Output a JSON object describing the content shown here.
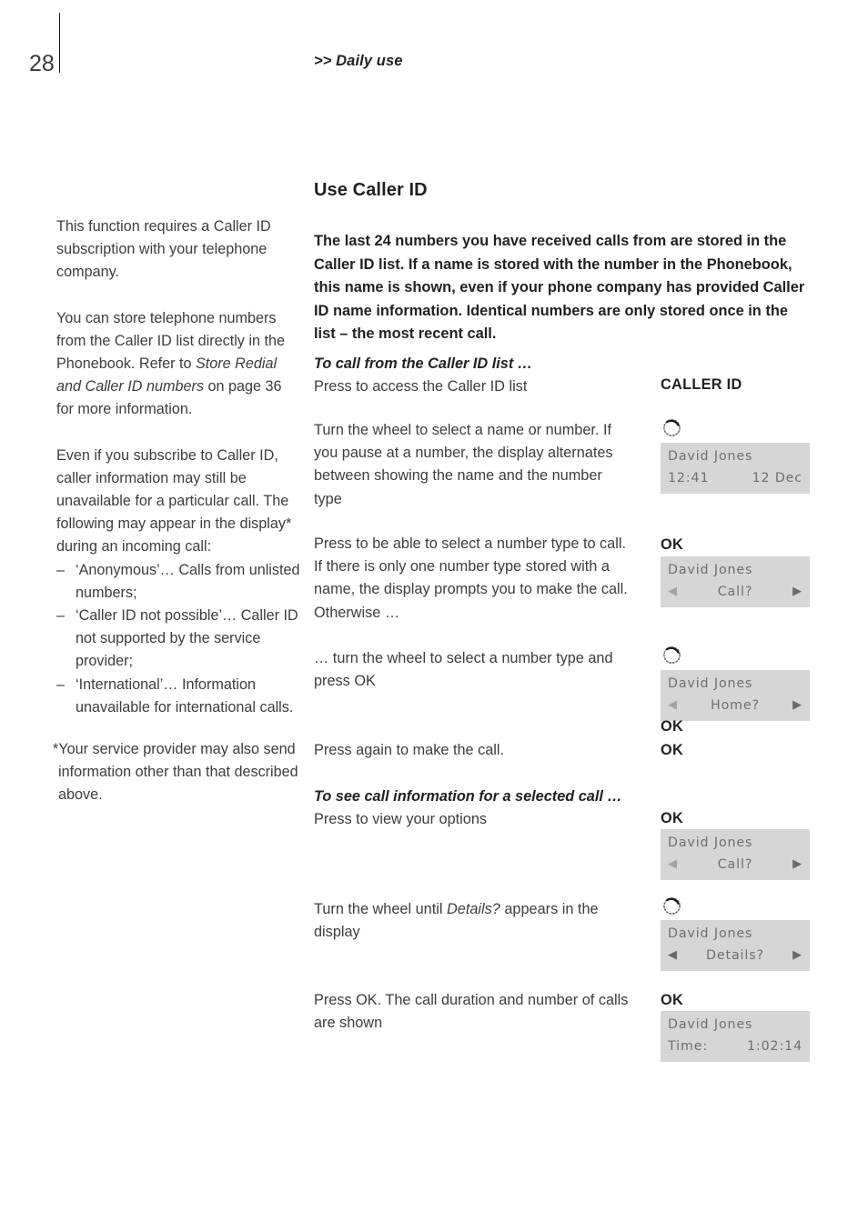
{
  "header": {
    "page_number": "28",
    "breadcrumb": ">> Daily use"
  },
  "sidebar": {
    "para1": "This function requires a Caller ID subscription with your telephone company.",
    "para2_a": "You can store telephone numbers from the Caller ID list directly in the Phonebook. Refer to ",
    "para2_em": "Store Redial and Caller ID numbers",
    "para2_b": " on page 36 for more information.",
    "para3": "Even if you subscribe to Caller ID, caller information may still be unavailable for a particular call. The following may appear in the display* during an incoming call:",
    "bullets": [
      "‘Anonymous’… Calls from unlisted numbers;",
      "‘Caller ID not possible’… Caller ID not supported by the service provider;",
      "‘International’… Information unavailable for international calls."
    ],
    "bullet_dash": "–",
    "footnote": "*Your service provider may also send information other than that described above."
  },
  "main": {
    "title": "Use Caller ID",
    "intro": "The last 24 numbers you have received calls from are stored in the Caller ID list. If a name is stored with the number in the Phonebook, this name is shown, even if your phone company has provided Caller ID name information. Identical numbers are only stored once in the list – the most recent call.",
    "steps": [
      {
        "subhead": "To call from the Caller ID list …",
        "body": "Press to access the Caller ID list",
        "key": "CALLER ID"
      },
      {
        "body": "Turn the wheel to select a name or number. If you pause at a number, the display alternates between showing the name and the number type",
        "icon": "wheel-icon",
        "display": {
          "name": "David Jones",
          "left": "12:41",
          "right": "12 Dec"
        }
      },
      {
        "body": "Press to be able to select a number type to call. If there is only one number type stored with a name, the display prompts you to make the call. Otherwise …",
        "key": "OK",
        "display": {
          "name": "David Jones",
          "center": "Call?",
          "arrow_left": "◀",
          "arrow_right": "▶"
        }
      },
      {
        "body": "… turn the wheel to select a number type and press OK",
        "icon": "wheel-icon",
        "display": {
          "name": "David Jones",
          "center": "Home?",
          "arrow_left": "◀",
          "arrow_right": "▶"
        },
        "key_after": "OK"
      },
      {
        "body": "Press again to make the call.",
        "key": "OK"
      },
      {
        "subhead": "To see call information for a selected call …",
        "body": "Press to view your options",
        "key": "OK",
        "display": {
          "name": "David Jones",
          "center": "Call?",
          "arrow_left": "◀",
          "arrow_right": "▶"
        }
      },
      {
        "body_a": "Turn the wheel until ",
        "body_em": "Details?",
        "body_b": " appears in the display",
        "icon": "wheel-icon",
        "display": {
          "name": "David Jones",
          "center": "Details?",
          "arrow_left": "◀",
          "arrow_right": "▶"
        }
      },
      {
        "body": "Press OK. The call duration and number of calls are shown",
        "key": "OK",
        "display": {
          "name": "David Jones",
          "left": "Time:",
          "right": "1:02:14"
        }
      }
    ]
  },
  "colors": {
    "text": "#3d3d3d",
    "heading": "#231f20",
    "display_bg": "#d6d6d6",
    "display_text": "#6e6e6e"
  }
}
